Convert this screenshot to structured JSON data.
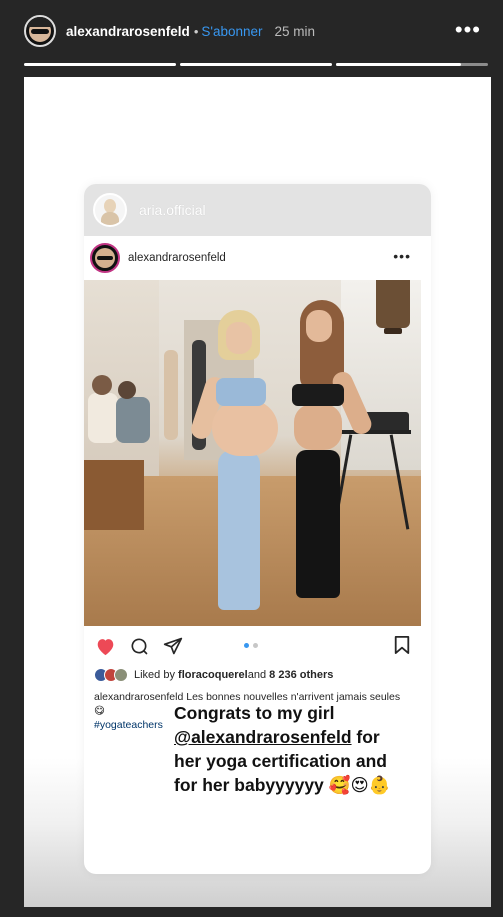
{
  "story": {
    "username": "alexandrarosenfeld",
    "dot": "•",
    "follow_label": "S'abonner",
    "time": "25 min",
    "more": "•••",
    "progress": [
      1.0,
      1.0,
      0.82
    ]
  },
  "shared_post": {
    "sharer_name": "aria.official",
    "author": "alexandrarosenfeld",
    "more": "•••",
    "carousel": {
      "count": 2,
      "active": 1
    },
    "likes": {
      "prefix": "Liked by ",
      "first_user": "floracoquerel",
      "middle": " and ",
      "count": "8 236 others"
    },
    "caption": {
      "user": "alexandrarosenfeld",
      "text": " Les bonnes nouvelles n'arrivent jamais seules 😋",
      "hashtag": "#yogateachers"
    }
  },
  "overlay": {
    "line1": "Congrats to my girl",
    "mention": "@alexandrarosenfeld",
    "line2_suffix": " for",
    "line3": "her yoga certification and",
    "line4": "for her babyyyyyy 🥰😍👶"
  },
  "colors": {
    "background": "#262626",
    "link_blue": "#3897f0",
    "heart_red": "#ed4956",
    "text_dark": "#262626"
  }
}
